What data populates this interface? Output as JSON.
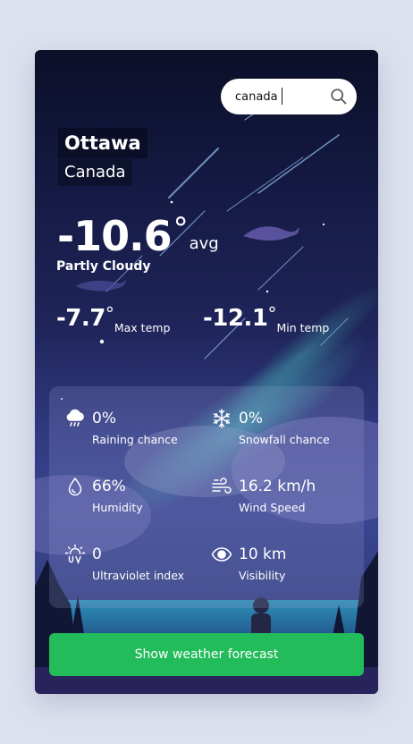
{
  "search": {
    "value": "canada"
  },
  "location": {
    "city": "Ottawa",
    "country": "Canada"
  },
  "current": {
    "avg_temp": "-10.6",
    "degree": "°",
    "avg_label": "avg",
    "condition": "Partly Cloudy"
  },
  "range": {
    "max": {
      "value": "-7.7",
      "degree": "°",
      "label": "Max temp"
    },
    "min": {
      "value": "-12.1",
      "degree": "°",
      "label": "Min temp"
    }
  },
  "stats": {
    "rain": {
      "value": "0%",
      "label": "Raining chance",
      "icon": "rain-cloud-icon"
    },
    "snow": {
      "value": "0%",
      "label": "Snowfall chance",
      "icon": "snowflake-icon"
    },
    "humidity": {
      "value": "66%",
      "label": "Humidity",
      "icon": "droplet-icon"
    },
    "wind": {
      "value": "16.2 km/h",
      "label": "Wind Speed",
      "icon": "wind-icon"
    },
    "uv": {
      "value": "0",
      "label": "Ultraviolet index",
      "icon": "uv-sun-icon"
    },
    "visibility": {
      "value": "10 km",
      "label": "Visibility",
      "icon": "eye-icon"
    }
  },
  "forecast_button": {
    "label": "Show weather forecast"
  },
  "colors": {
    "page_bg": "#dde1ef",
    "accent_green": "#22bc5b",
    "card_dark": "#151a44"
  }
}
